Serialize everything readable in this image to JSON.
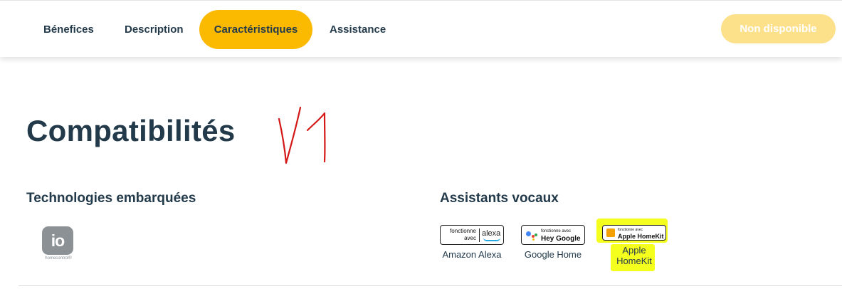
{
  "nav": {
    "tabs": [
      {
        "label": "Bénefices",
        "active": false
      },
      {
        "label": "Description",
        "active": false
      },
      {
        "label": "Caractéristiques",
        "active": true
      },
      {
        "label": "Assistance",
        "active": false
      }
    ],
    "status_button": "Non disponible",
    "accent_color": "#fbb900"
  },
  "page": {
    "title": "Compatibilités",
    "annotation": "V1"
  },
  "technologies": {
    "heading": "Technologies embarquées",
    "logo_text": "io",
    "logo_caption": "homecontrol®"
  },
  "assistants": {
    "heading": "Assistants vocaux",
    "items": [
      {
        "badge_line1": "fonctionne",
        "badge_line2": "avec",
        "badge_brand": "alexa",
        "label": "Amazon Alexa"
      },
      {
        "badge_line1": "fonctionne avec",
        "badge_brand": "Hey Google",
        "label": "Google Home"
      },
      {
        "badge_line1": "fonctionne avec",
        "badge_brand": "Apple HomeKit",
        "label_line1": "Apple",
        "label_line2": "HomeKit"
      }
    ],
    "highlight_color": "#f5ff1e"
  }
}
